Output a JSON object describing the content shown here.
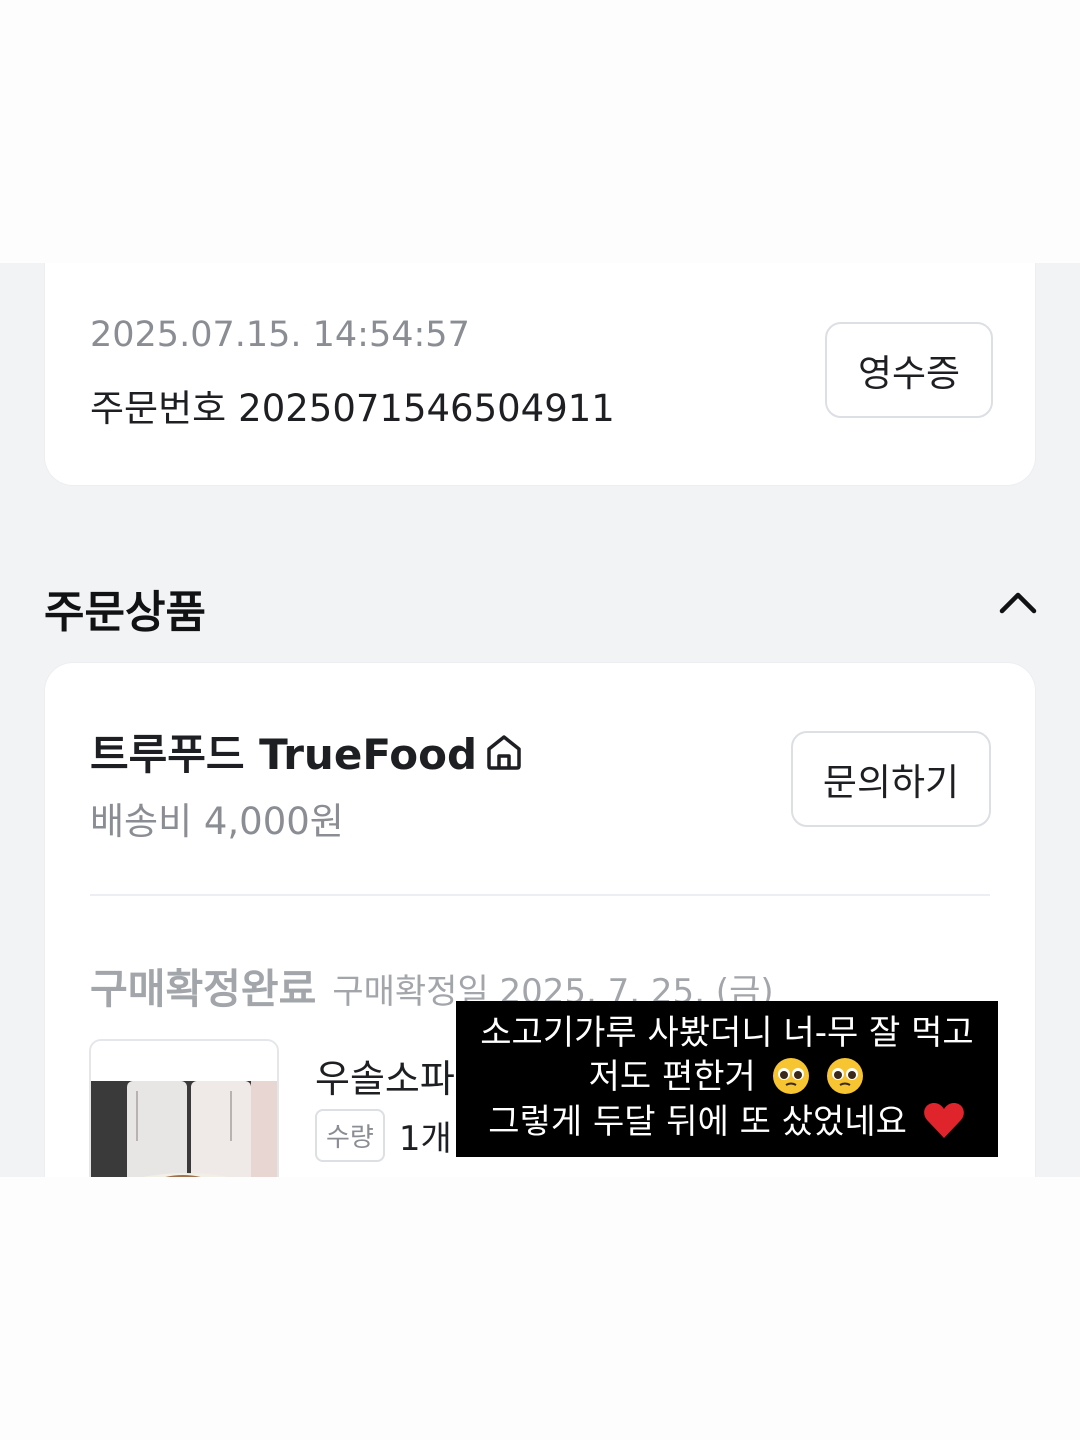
{
  "order_info": {
    "timestamp": "2025.07.15. 14:54:57",
    "order_number_label": "주문번호",
    "order_number": "2025071546504911",
    "receipt_button": "영수증"
  },
  "section": {
    "title": "주문상품",
    "collapse_icon": "chevron-up-icon"
  },
  "seller": {
    "name": "트루푸드 TrueFood",
    "store_icon": "home-icon",
    "shipping_fee": "배송비 4,000원",
    "inquiry_button": "문의하기"
  },
  "item": {
    "status": "구매확정완료",
    "confirm_date": "구매확정일 2025. 7. 25. (금)",
    "product_name": "우솔소파",
    "quantity_label": "수량",
    "quantity_value": "1개"
  },
  "caption": {
    "line1": "소고기가루 사봤더니 너-무 잘 먹고",
    "line2": "저도 편한거",
    "line3": "그렇게 두달 뒤에 또 샀었네요",
    "emoji_1": "pleading-face-icon",
    "emoji_2": "red-heart-icon"
  },
  "colors": {
    "background": "#f2f3f5",
    "card": "#ffffff",
    "muted_text": "#8a8d93",
    "caption_bg": "#000000"
  }
}
